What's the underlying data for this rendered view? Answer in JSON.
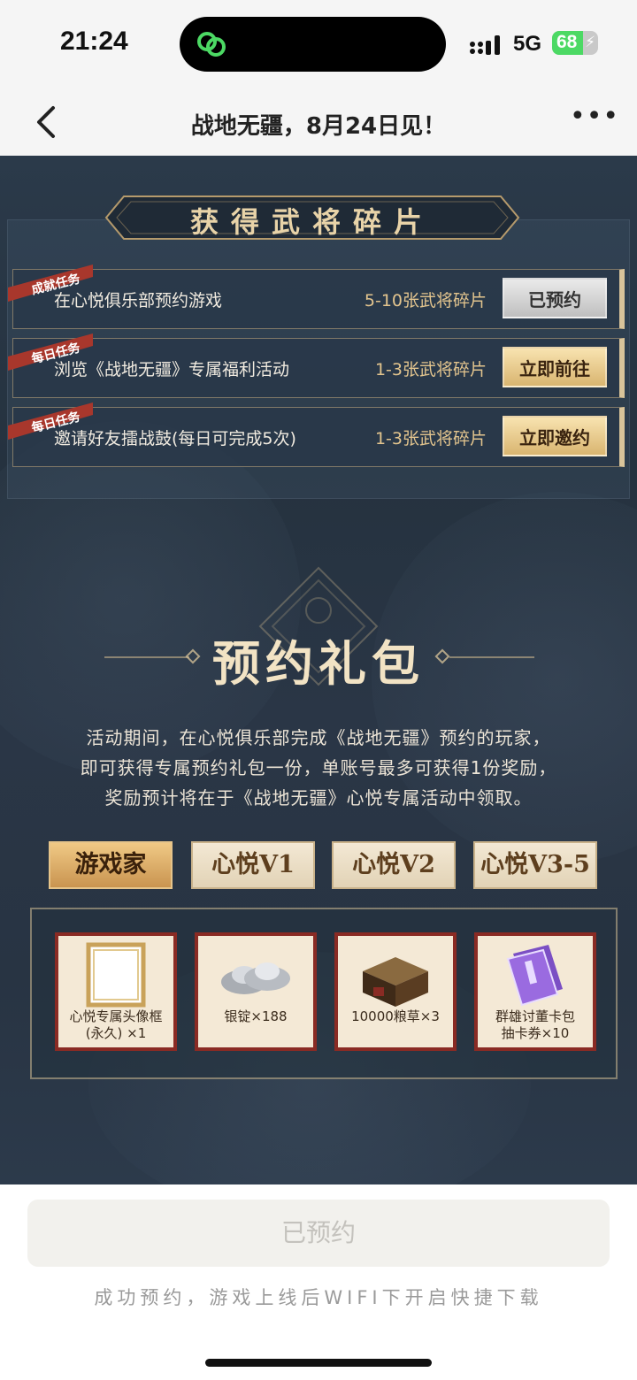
{
  "status_bar": {
    "time": "21:24",
    "network": "5G",
    "battery_percent": "68",
    "battery_level": 0.68
  },
  "nav": {
    "title": "战地无疆，8月24日见！"
  },
  "tasks_section": {
    "title": "获得武将碎片",
    "tasks": [
      {
        "tag": "成就任务",
        "name": "在心悦俱乐部预约游戏",
        "reward": "5-10张武将碎片",
        "button": "已预约"
      },
      {
        "tag": "每日任务",
        "name": "浏览《战地无疆》专属福利活动",
        "reward": "1-3张武将碎片",
        "button": "立即前往"
      },
      {
        "tag": "每日任务",
        "name": "邀请好友擂战鼓(每日可完成5次)",
        "reward": "1-3张武将碎片",
        "button": "立即邀约"
      }
    ]
  },
  "gift_section": {
    "title": "预约礼包",
    "description": [
      "活动期间，在心悦俱乐部完成《战地无疆》预约的玩家，",
      "即可获得专属预约礼包一份，单账号最多可获得1份奖励，",
      "奖励预计将在于《战地无疆》心悦专属活动中领取。"
    ],
    "tiers": [
      "游戏家",
      "心悦V1",
      "心悦V2",
      "心悦V3-5"
    ],
    "active_tier": "游戏家",
    "rewards": [
      {
        "line1": "心悦专属头像框",
        "line2": "(永久) ×1"
      },
      {
        "line1": "银锭×188",
        "line2": ""
      },
      {
        "line1": "10000粮草×3",
        "line2": ""
      },
      {
        "line1": "群雄讨董卡包",
        "line2": "抽卡券×10"
      }
    ]
  },
  "footer": {
    "button": "已预约",
    "hint": "成功预约，游戏上线后WIFI下开启快捷下载"
  },
  "colors": {
    "page_bg": "#2b3a4a",
    "gold": "#e3c58e",
    "tag_red": "#a8372c"
  }
}
